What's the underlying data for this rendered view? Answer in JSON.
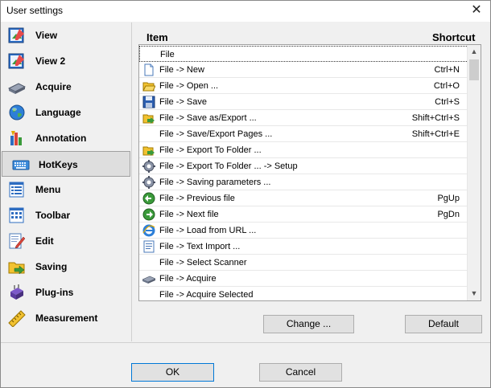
{
  "window": {
    "title": "User settings",
    "close_glyph": "✕"
  },
  "sidebar": {
    "items": [
      {
        "label": "View",
        "icon": "view-icon"
      },
      {
        "label": "View 2",
        "icon": "view2-icon"
      },
      {
        "label": "Acquire",
        "icon": "scanner-icon"
      },
      {
        "label": "Language",
        "icon": "globe-icon"
      },
      {
        "label": "Annotation",
        "icon": "annotation-icon"
      },
      {
        "label": "HotKeys",
        "icon": "keyboard-icon",
        "selected": true
      },
      {
        "label": "Menu",
        "icon": "menu-icon"
      },
      {
        "label": "Toolbar",
        "icon": "toolbar-icon"
      },
      {
        "label": "Edit",
        "icon": "edit-icon"
      },
      {
        "label": "Saving",
        "icon": "saving-icon"
      },
      {
        "label": "Plug-ins",
        "icon": "plugin-icon"
      },
      {
        "label": "Measurement",
        "icon": "ruler-icon"
      }
    ]
  },
  "hotkeys": {
    "header_item": "Item",
    "header_shortcut": "Shortcut",
    "rows": [
      {
        "label": "File",
        "shortcut": "",
        "icon": ""
      },
      {
        "label": "File -> New",
        "shortcut": "Ctrl+N",
        "icon": "new-file-icon"
      },
      {
        "label": "File -> Open ...",
        "shortcut": "Ctrl+O",
        "icon": "folder-icon"
      },
      {
        "label": "File -> Save",
        "shortcut": "Ctrl+S",
        "icon": "save-icon"
      },
      {
        "label": "File -> Save as/Export ...",
        "shortcut": "Shift+Ctrl+S",
        "icon": "save-as-icon"
      },
      {
        "label": "File -> Save/Export Pages ...",
        "shortcut": "Shift+Ctrl+E",
        "icon": ""
      },
      {
        "label": "File -> Export To Folder ...",
        "shortcut": "",
        "icon": "export-folder-icon"
      },
      {
        "label": "File -> Export To Folder ... -> Setup",
        "shortcut": "",
        "icon": "gear-icon"
      },
      {
        "label": "File -> Saving parameters ...",
        "shortcut": "",
        "icon": "gear-icon"
      },
      {
        "label": "File -> Previous file",
        "shortcut": "PgUp",
        "icon": "arrow-left-icon"
      },
      {
        "label": "File -> Next file",
        "shortcut": "PgDn",
        "icon": "arrow-right-icon"
      },
      {
        "label": "File -> Load from URL ...",
        "shortcut": "",
        "icon": "ie-icon"
      },
      {
        "label": "File -> Text Import ...",
        "shortcut": "",
        "icon": "text-doc-icon"
      },
      {
        "label": "File -> Select Scanner",
        "shortcut": "",
        "icon": ""
      },
      {
        "label": "File -> Acquire",
        "shortcut": "",
        "icon": "scanner-icon"
      },
      {
        "label": "File -> Acquire Selected",
        "shortcut": "",
        "icon": ""
      }
    ]
  },
  "buttons": {
    "change": "Change ...",
    "default": "Default",
    "ok": "OK",
    "cancel": "Cancel"
  }
}
